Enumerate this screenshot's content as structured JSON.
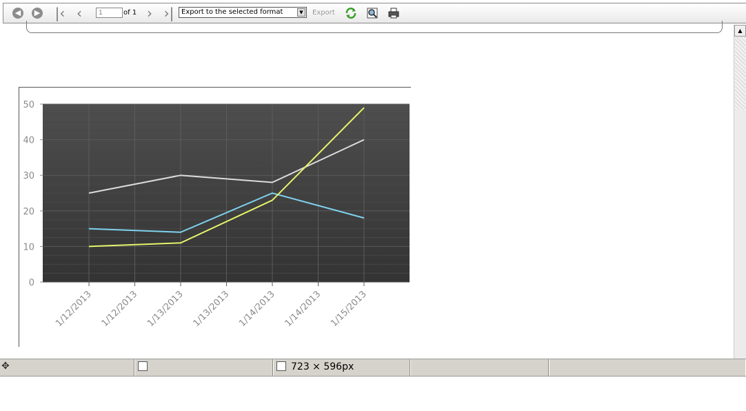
{
  "toolbar": {
    "page_current": "1",
    "page_of": "of 1",
    "format_selected": "Export to the selected format",
    "export_label": "Export",
    "icons": [
      "back-icon",
      "forward-icon",
      "first-page-icon",
      "previous-page-icon",
      "next-page-icon",
      "last-page-icon",
      "refresh-icon",
      "print-preview-icon",
      "print-icon"
    ]
  },
  "status": {
    "size_text": "723 × 596px"
  },
  "chart_data": {
    "type": "line",
    "categories": [
      "1/12/2013",
      "1/12/2013",
      "1/13/2013",
      "1/13/2013",
      "1/14/2013",
      "1/14/2013",
      "1/15/2013"
    ],
    "x": [
      0,
      1,
      2,
      3,
      4,
      5,
      6
    ],
    "ylim": [
      0,
      50
    ],
    "yticks": [
      "0",
      "10",
      "20",
      "30",
      "40",
      "50"
    ],
    "grid": true,
    "series": [
      {
        "color": "#dcdcdc",
        "points": [
          [
            0,
            25
          ],
          [
            2,
            30
          ],
          [
            4,
            28
          ],
          [
            6,
            40
          ]
        ]
      },
      {
        "color": "#7fd3f0",
        "points": [
          [
            0,
            15
          ],
          [
            2,
            14
          ],
          [
            4,
            25
          ],
          [
            6,
            18
          ]
        ]
      },
      {
        "color": "#e6f56a",
        "points": [
          [
            0,
            10
          ],
          [
            2,
            11
          ],
          [
            4,
            23
          ],
          [
            6,
            49
          ]
        ]
      }
    ]
  }
}
